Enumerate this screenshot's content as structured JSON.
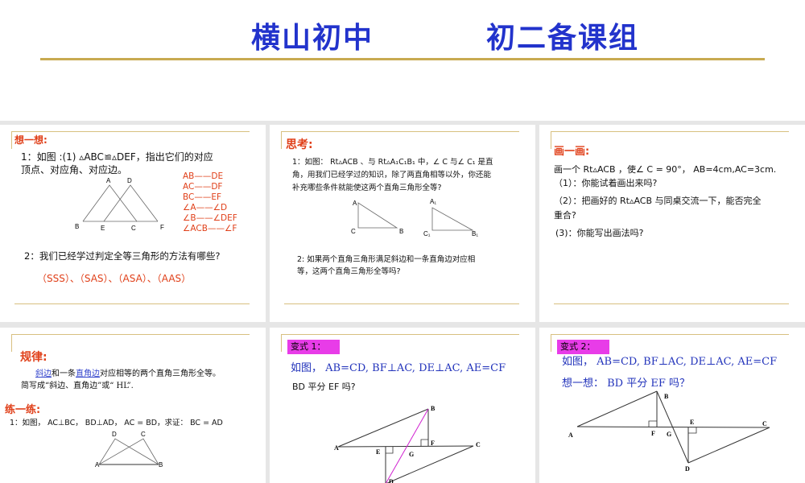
{
  "header": {
    "title_left": "横山初中",
    "title_right": "初二备课组"
  },
  "slides": [
    {
      "title": "想一想:",
      "line1": "1：如图 :(1) ▵ABC≌▵DEF，指出它们的对应",
      "line2": "顶点、对应角、对应边。",
      "pairs": [
        "AB——DE",
        "AC——DF",
        "BC——EF",
        "∠A——∠D",
        "∠B——∠DEF",
        "∠ACB——∠F"
      ],
      "q2": "2：我们已经学过判定全等三角形的方法有哪些?",
      "answer": "（SSS）、（SAS）、（ASA）、（AAS）",
      "labels": [
        "A",
        "D",
        "B",
        "E",
        "C",
        "F"
      ]
    },
    {
      "title": "思考:",
      "lines": [
        "1：如图： Rt▵ACB 、与 Rt▵A₁C₁B₁ 中，∠ C 与∠ C₁ 是直",
        "角，用我们已经学过的知识，除了两直角相等以外，你还能",
        "补充哪些条件就能使这两个直角三角形全等?"
      ],
      "q2": [
        "2:  如果两个直角三角形满足斜边和一条直角边对应相",
        "等，这两个直角三角形全等吗?"
      ],
      "labels": [
        "A",
        "C",
        "B",
        "A₁",
        "C₁",
        "B₁"
      ]
    },
    {
      "title": "画一画:",
      "lines": [
        "画一个 Rt▵ACB ，使∠ C = 90°，  AB=4cm,AC=3cm.",
        "（1）：你能试着画出来吗?",
        "（2）：把画好的 Rt▵ACB 与同桌交流一下，能否完全",
        "重合?",
        " (3)：你能写出画法吗?"
      ]
    },
    {
      "title": "规律:",
      "rule_link1": "斜边",
      "rule_mid": "和一条",
      "rule_link2": "直角边",
      "rule_end": "对应相等的两个直角三角形全等。",
      "rule2": "简写成“斜边、直角边”或“ HL”.",
      "practice_title": "练一练:",
      "practice": "1：如图， AC⊥BC，  BD⊥AD，    AC = BD，求证： BC = AD",
      "labels": [
        "D",
        "C",
        "A",
        "B"
      ]
    },
    {
      "tag": "变式 1：",
      "line1": "如图， AB=CD,  BF⊥AC, DE⊥AC, AE=CF",
      "line2": "BD 平分 EF 吗?",
      "labels": [
        "A",
        "B",
        "C",
        "D",
        "E",
        "F",
        "G"
      ]
    },
    {
      "tag": "变式 2：",
      "line1": "如图， AB=CD,  BF⊥AC, DE⊥AC, AE=CF",
      "line2": "想一想： BD 平分 EF 吗？",
      "labels": [
        "A",
        "B",
        "C",
        "D",
        "E",
        "F",
        "G"
      ]
    }
  ]
}
